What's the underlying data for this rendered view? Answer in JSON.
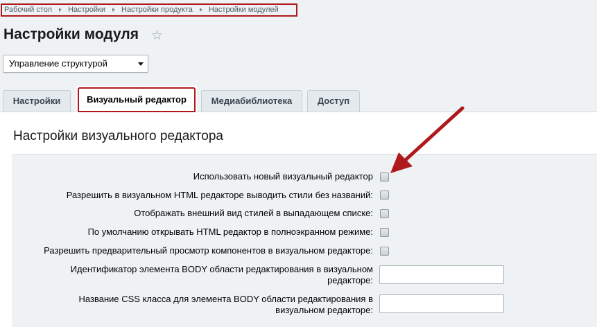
{
  "breadcrumb": [
    "Рабочий стол",
    "Настройки",
    "Настройки продукта",
    "Настройки модулей"
  ],
  "page_title": "Настройки модуля",
  "select": {
    "value": "Управление структурой"
  },
  "tabs": [
    {
      "label": "Настройки",
      "active": false
    },
    {
      "label": "Визуальный редактор",
      "active": true
    },
    {
      "label": "Медиабиблиотека",
      "active": false
    },
    {
      "label": "Доступ",
      "active": false
    }
  ],
  "section_title": "Настройки визуального редактора",
  "options": [
    {
      "label": "Использовать новый визуальный редактор",
      "type": "checkbox",
      "checked": false
    },
    {
      "label": "Разрешить в визуальном HTML редакторе выводить стили без названий:",
      "type": "checkbox",
      "checked": false
    },
    {
      "label": "Отображать внешний вид стилей в выпадающем списке:",
      "type": "checkbox",
      "checked": false
    },
    {
      "label": "По умолчанию открывать HTML редактор в полноэкранном режиме:",
      "type": "checkbox",
      "checked": false
    },
    {
      "label": "Разрешить предварительный просмотр компонентов в визуальном редакторе:",
      "type": "checkbox",
      "checked": false
    },
    {
      "label": "Идентификатор элемента BODY области редактирования в визуальном редакторе:",
      "type": "text",
      "value": ""
    },
    {
      "label": "Название CSS класса для элемента BODY области редактирования в визуальном редакторе:",
      "type": "text",
      "value": ""
    }
  ],
  "colors": {
    "highlight": "#b0191c",
    "background": "#eef2f4"
  }
}
